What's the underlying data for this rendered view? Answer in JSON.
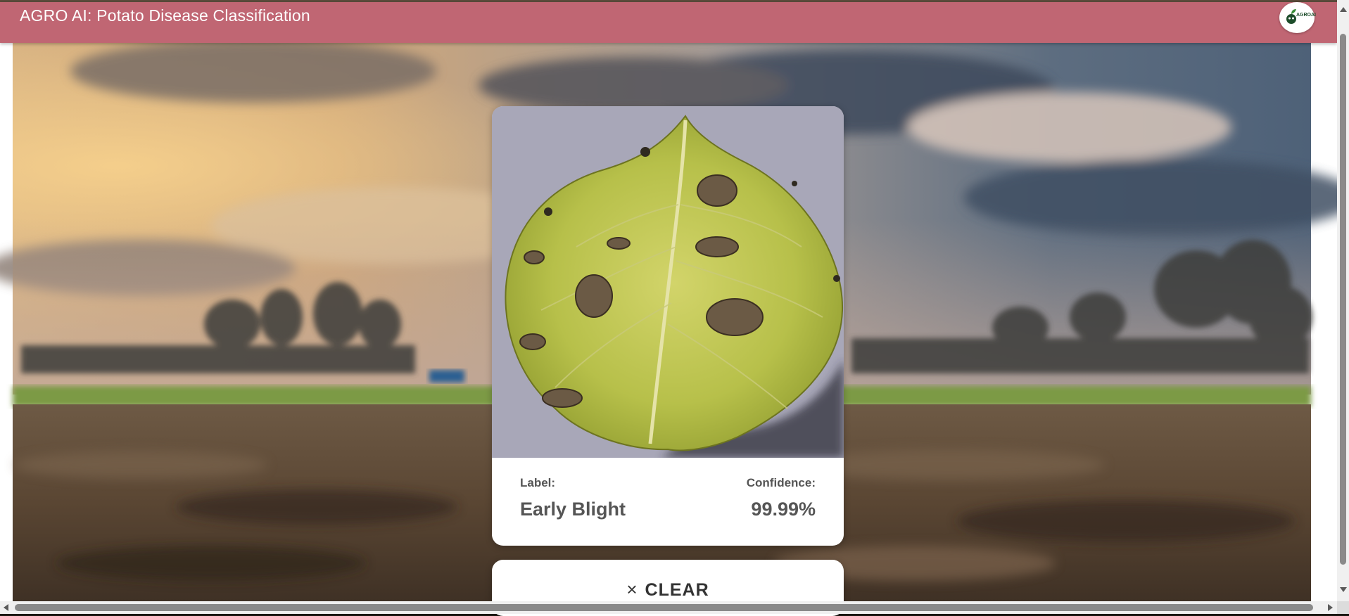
{
  "header": {
    "title": "AGRO AI: Potato Disease Classification",
    "logo_text": "AGROAI",
    "logo_icon": "leaf-sprout-icon",
    "color": "#c06673"
  },
  "result": {
    "label_title": "Label:",
    "label_value": "Early Blight",
    "confidence_title": "Confidence:",
    "confidence_value": "99.99%"
  },
  "actions": {
    "clear_label": "CLEAR",
    "clear_icon": "×"
  },
  "colors": {
    "accent": "#c06673",
    "card": "#ffffff",
    "text": "#555555"
  }
}
